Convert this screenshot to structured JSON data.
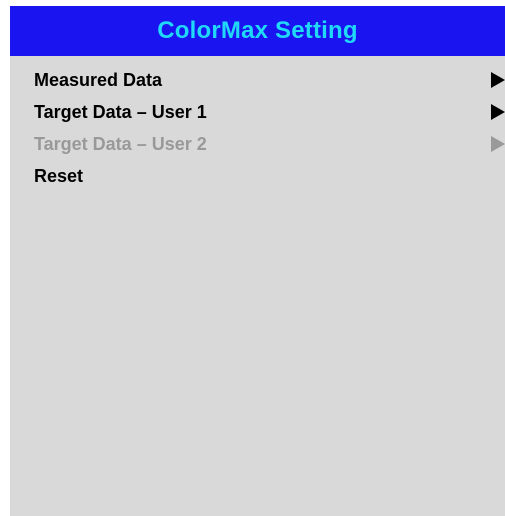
{
  "menu": {
    "title": "ColorMax Setting",
    "colors": {
      "header_bg": "#1a14f0",
      "title": "#20d8f8",
      "panel_bg": "#d9d9d9",
      "text": "#000000",
      "disabled": "#999999"
    },
    "items": [
      {
        "label": "Measured Data",
        "has_submenu": true,
        "enabled": true,
        "icon": "triangle-right-icon"
      },
      {
        "label": "Target Data – User 1",
        "has_submenu": true,
        "enabled": true,
        "icon": "triangle-right-icon"
      },
      {
        "label": "Target Data – User 2",
        "has_submenu": true,
        "enabled": false,
        "icon": "triangle-right-icon"
      },
      {
        "label": "Reset",
        "has_submenu": false,
        "enabled": true
      }
    ]
  }
}
